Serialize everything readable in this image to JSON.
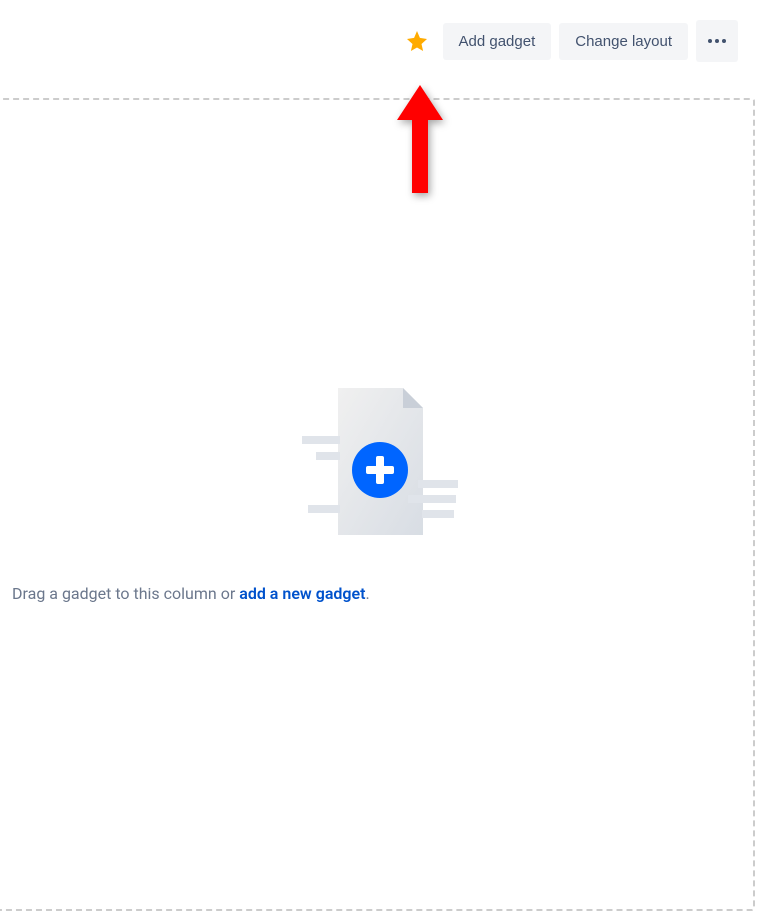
{
  "toolbar": {
    "add_gadget_label": "Add gadget",
    "change_layout_label": "Change layout",
    "star_icon": "star-icon",
    "more_icon": "more-icon"
  },
  "empty_state": {
    "hint_prefix": "Drag a gadget to this column or ",
    "hint_link": "add a new gadget",
    "hint_suffix": "."
  }
}
